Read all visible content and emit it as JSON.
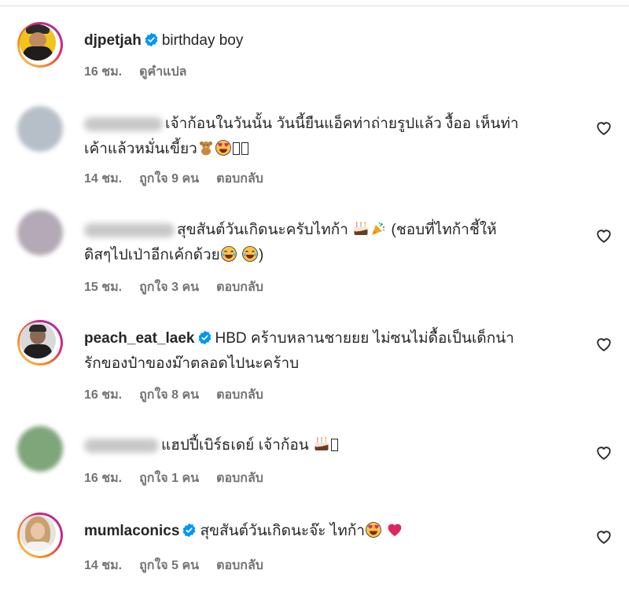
{
  "comments": [
    {
      "username": "djpetjah",
      "verified": true,
      "text": "birthday boy",
      "time": "16 ชม.",
      "likes": "",
      "action": "ดูคำแปล"
    },
    {
      "username": "",
      "verified": false,
      "text_line1": "เจ้าก้อนในวันนั้น วันนี้ยืนแอ็คท่าถ่ายรูปแล้ว งื้ออ เห็นท่า",
      "text_line2": "เค้าแล้วหมั่นเขี้ยว",
      "time": "14 ชม.",
      "likes": "ถูกใจ 9 คน",
      "action": "ตอบกลับ"
    },
    {
      "username": "",
      "verified": false,
      "text_line1a": "สุขสันต์วันเกิดนะครับไทก้า",
      "text_line1b": "(ชอบที่ไทก้าชี้ให้",
      "text_line2": "ดิสๆไปเป่าอีกเค้กด้วย",
      "text_line2b": ")",
      "time": "15 ชม.",
      "likes": "ถูกใจ 3 คน",
      "action": "ตอบกลับ"
    },
    {
      "username": "peach_eat_laek",
      "verified": true,
      "text_line1": "HBD คร้าบหลานชายยย ไม่ซนไม่ดื้อเป็นเด็กน่า",
      "text_line2": "รักของป๋าของม๊าตลอดไปนะคร้าบ",
      "time": "16 ชม.",
      "likes": "ถูกใจ 8 คน",
      "action": "ตอบกลับ"
    },
    {
      "username": "",
      "verified": false,
      "text": "แฮปปี้เบิร์ธเดย์ เจ้าก้อน",
      "time": "16 ชม.",
      "likes": "ถูกใจ 1 คน",
      "action": "ตอบกลับ"
    },
    {
      "username": "mumlaconics",
      "verified": true,
      "text": "สุขสันต์วันเกิดนะจ๊ะ ไทก้า",
      "time": "14 ชม.",
      "likes": "ถูกใจ 5 คน",
      "action": "ตอบกลับ"
    }
  ],
  "colors": {
    "text": "#262626",
    "meta": "#737373",
    "verified": "#0095f6",
    "heart_red": "#e0245e"
  },
  "icons": [
    "verified-badge-icon",
    "heart-outline-icon",
    "heart-emoji-icon",
    "heart-eyes-emoji-icon",
    "teddy-bear-emoji-icon",
    "cake-emoji-icon",
    "party-popper-emoji-icon",
    "tears-of-joy-emoji-icon"
  ]
}
